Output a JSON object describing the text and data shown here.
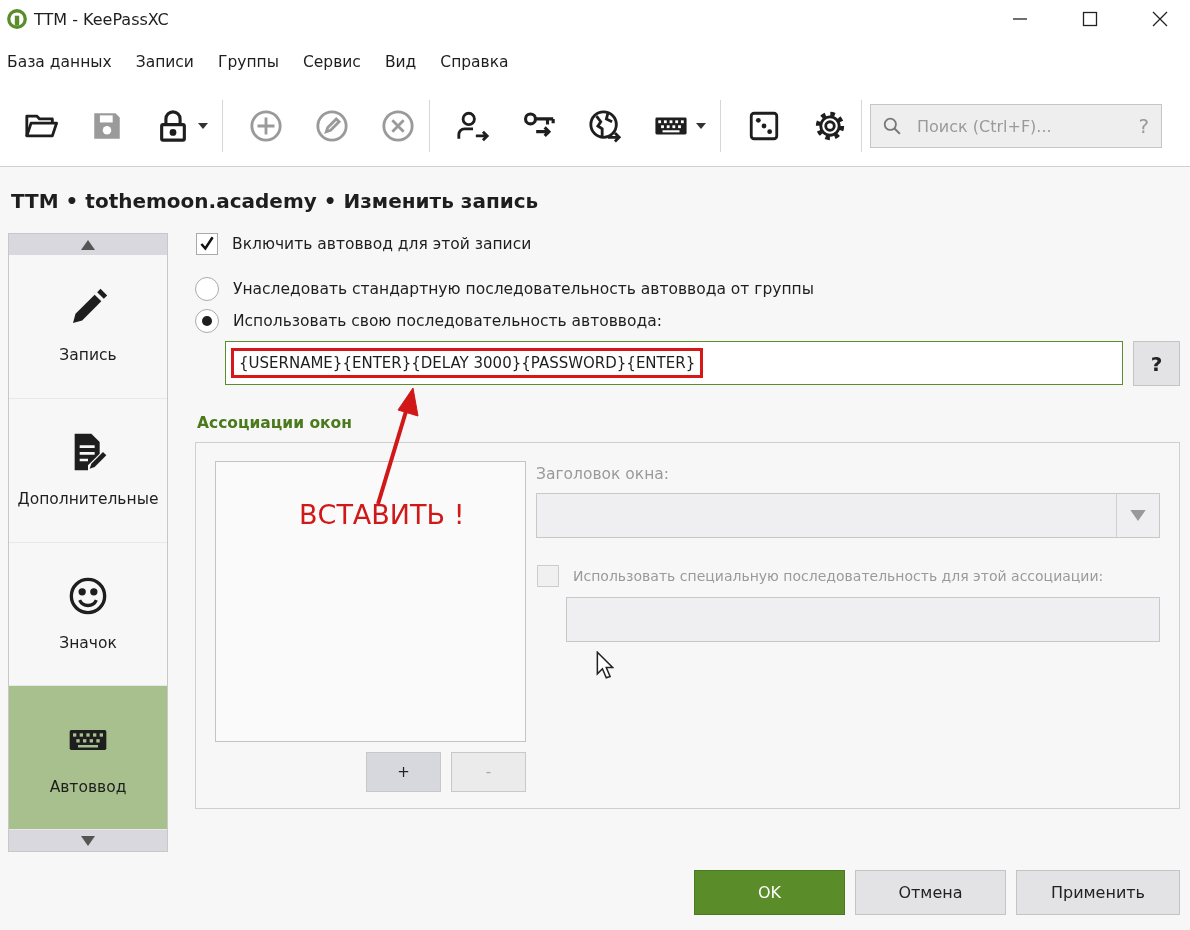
{
  "window": {
    "title": "TTM - KeePassXC"
  },
  "menu": [
    "База данных",
    "Записи",
    "Группы",
    "Сервис",
    "Вид",
    "Справка"
  ],
  "toolbar": {
    "groups": [
      [
        {
          "disabled": false,
          "dropdown": false
        },
        {
          "disabled": true,
          "dropdown": false
        },
        {
          "disabled": false,
          "dropdown": true
        }
      ],
      [
        {
          "disabled": true,
          "dropdown": false
        },
        {
          "disabled": true,
          "dropdown": false
        },
        {
          "disabled": true,
          "dropdown": false
        }
      ],
      [
        {
          "disabled": false,
          "dropdown": false
        },
        {
          "disabled": false,
          "dropdown": false
        },
        {
          "disabled": false,
          "dropdown": false
        },
        {
          "disabled": false,
          "dropdown": true
        }
      ],
      [
        {
          "disabled": false,
          "dropdown": false
        },
        {
          "disabled": false,
          "dropdown": false
        }
      ]
    ]
  },
  "search": {
    "placeholder": "Поиск (Ctrl+F)...",
    "help": "?"
  },
  "heading": "TTM • tothemoon.academy • Изменить запись",
  "sidebar": {
    "items": [
      {
        "label": "Запись",
        "selected": false
      },
      {
        "label": "Дополнительные",
        "selected": false
      },
      {
        "label": "Значок",
        "selected": false
      },
      {
        "label": "Автоввод",
        "selected": true
      }
    ]
  },
  "autotype": {
    "enable": {
      "label": "Включить автоввод для этой записи",
      "checked": true
    },
    "options": [
      {
        "label": "Унаследовать стандартную последовательность автоввода от группы",
        "selected": false
      },
      {
        "label": "Использовать свою последовательность автоввода:",
        "selected": true
      }
    ],
    "sequence": "{USERNAME}{ENTER}{DELAY 3000}{PASSWORD}{ENTER}",
    "help": "?"
  },
  "window_associations": {
    "title": "Ассоциации окон",
    "add": "+",
    "remove": "-",
    "window_title_label": "Заголовок окна:",
    "custom": {
      "label": "Использовать специальную последовательность для этой ассоциации:",
      "checked": false
    }
  },
  "buttons": [
    {
      "label": "OK",
      "primary": true
    },
    {
      "label": "Отмена",
      "primary": false
    },
    {
      "label": "Применить",
      "primary": false
    }
  ],
  "annotation": {
    "text": "ВСТАВИТЬ !"
  }
}
